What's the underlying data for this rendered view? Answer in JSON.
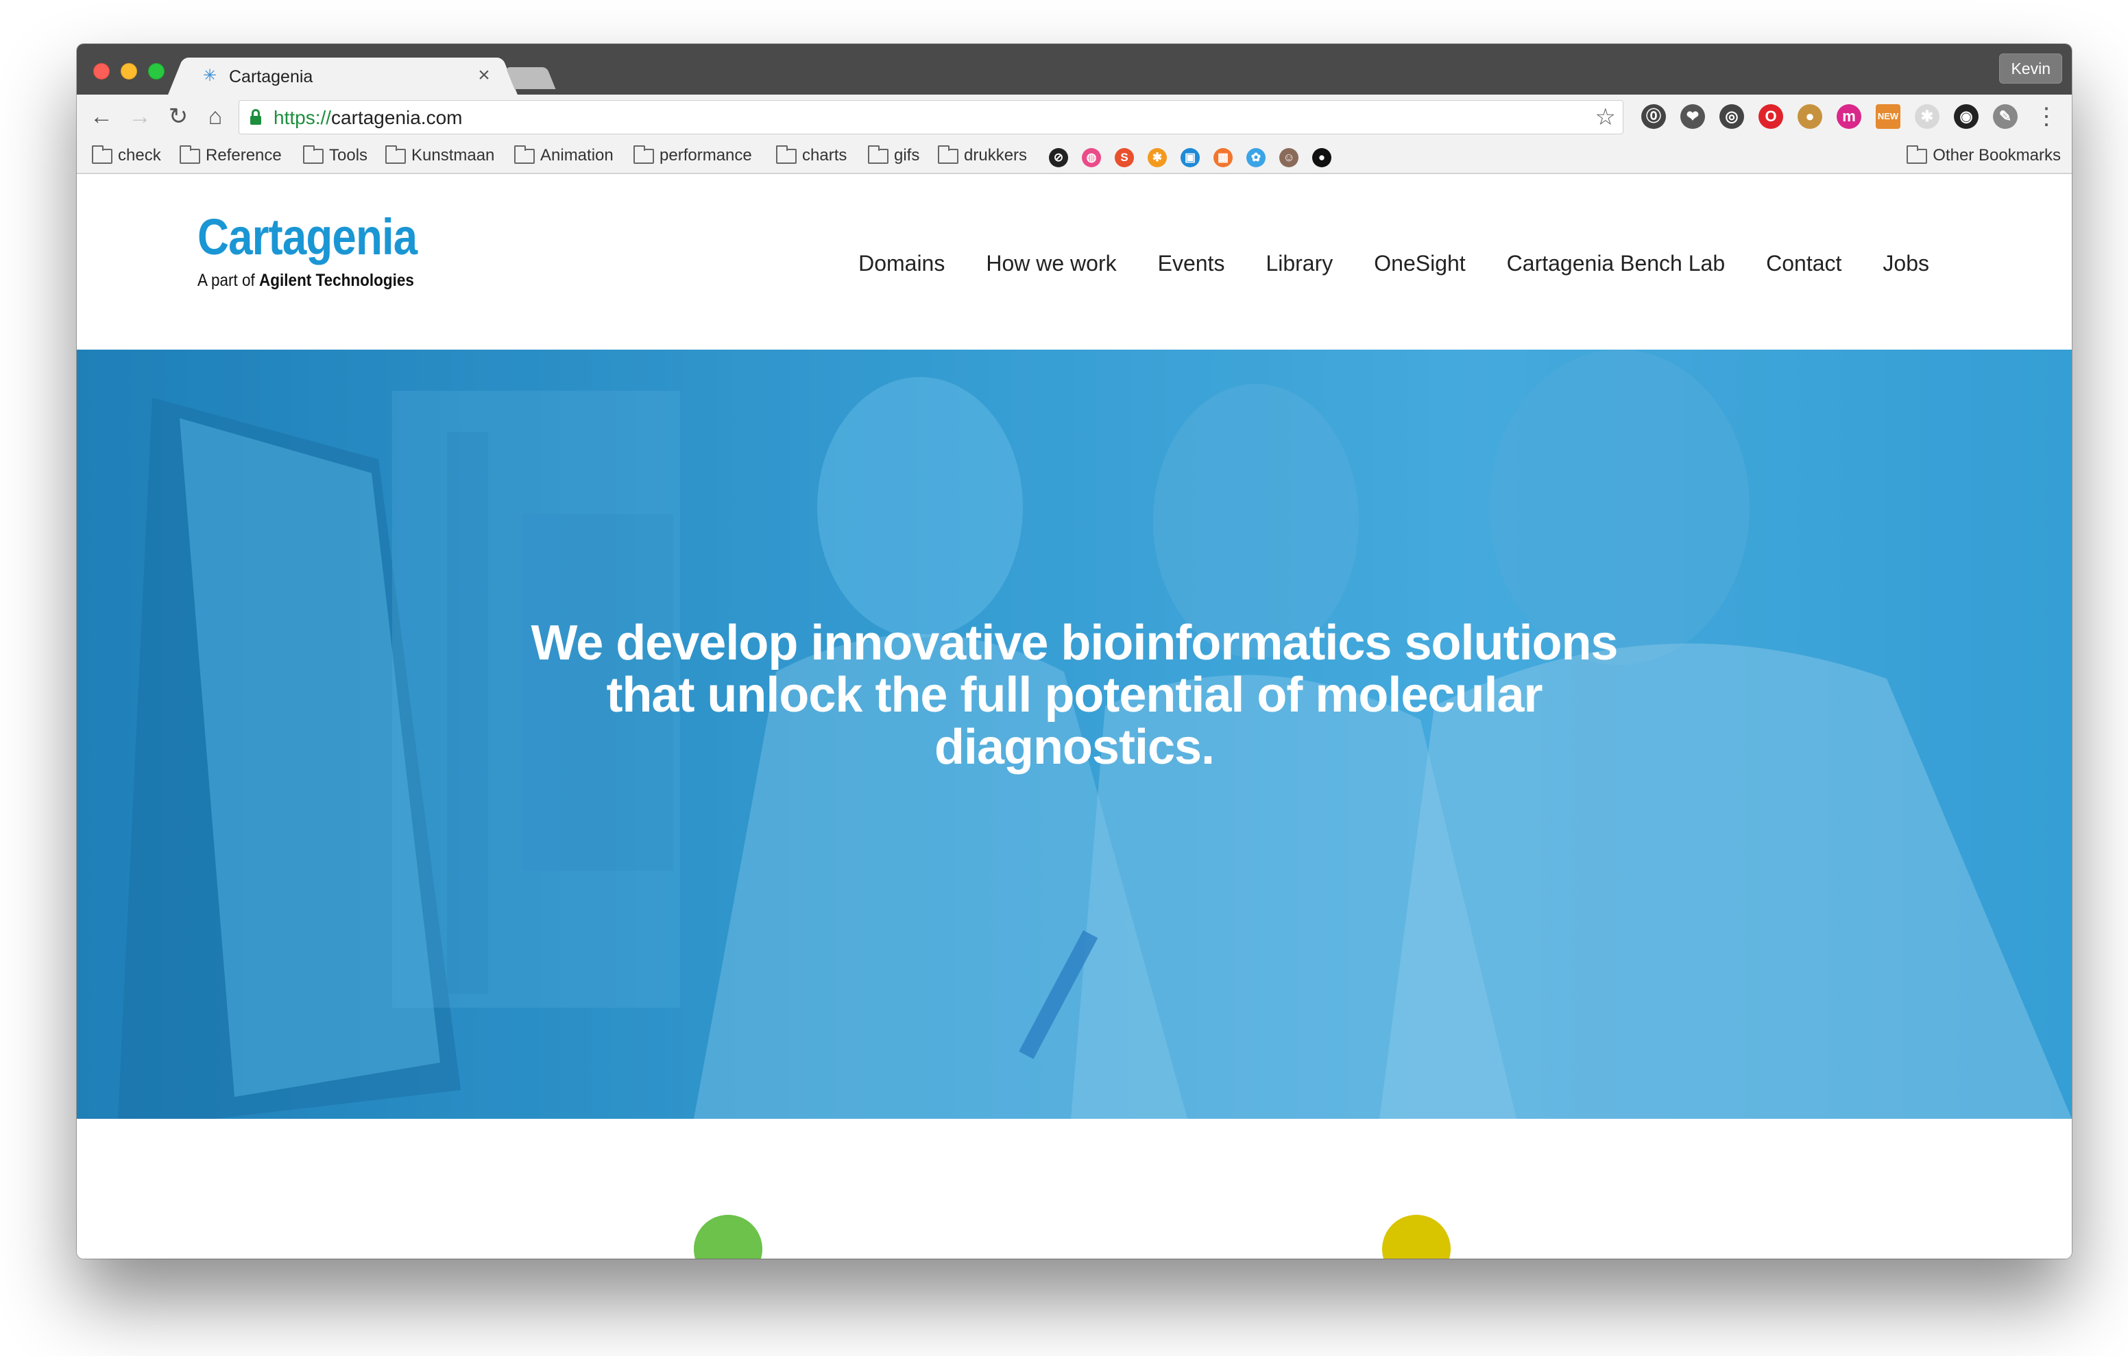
{
  "browser": {
    "tab_title": "Cartagenia",
    "url_scheme": "https://",
    "url_host": "cartagenia.com",
    "profile_name": "Kevin",
    "extensions": [
      {
        "name": "1password-icon",
        "color": "#444444",
        "glyph": "⓪"
      },
      {
        "name": "pocket-icon",
        "color": "#555555",
        "glyph": "❤"
      },
      {
        "name": "globe-icon",
        "color": "#444444",
        "glyph": "◎"
      },
      {
        "name": "opera-icon",
        "color": "#e0232a",
        "glyph": "O"
      },
      {
        "name": "cookie-icon",
        "color": "#c7923e",
        "glyph": "●"
      },
      {
        "name": "m-script-icon",
        "color": "#d9288a",
        "glyph": "m"
      },
      {
        "name": "new-badge-icon",
        "color": "#e58a2e",
        "glyph": "NEW"
      },
      {
        "name": "puzzle-icon",
        "color": "#d8d8d8",
        "glyph": "✱"
      },
      {
        "name": "colorpicker-icon",
        "color": "#222222",
        "glyph": "◉"
      },
      {
        "name": "eraser-icon",
        "color": "#888888",
        "glyph": "✎"
      }
    ]
  },
  "bookmarks": {
    "folders": [
      "check",
      "Reference",
      "Tools",
      "Kunstmaan",
      "Animation",
      "performance",
      "charts",
      "gifs",
      "drukkers"
    ],
    "icons": [
      {
        "name": "no-icon",
        "color": "#222222",
        "glyph": "⊘"
      },
      {
        "name": "dribbble-icon",
        "color": "#ea4c89",
        "glyph": "◍"
      },
      {
        "name": "s-icon",
        "color": "#e8502e",
        "glyph": "S"
      },
      {
        "name": "asterisk-icon",
        "color": "#f39a1e",
        "glyph": "✱"
      },
      {
        "name": "photo-icon",
        "color": "#1f8ad6",
        "glyph": "▣"
      },
      {
        "name": "orange-square-icon",
        "color": "#f2762e",
        "glyph": "▦"
      },
      {
        "name": "blue-circle-icon",
        "color": "#3ba4e6",
        "glyph": "✿"
      },
      {
        "name": "avatar-icon",
        "color": "#8a6b5a",
        "glyph": "☺"
      },
      {
        "name": "github-icon",
        "color": "#111111",
        "glyph": "●"
      }
    ],
    "other": "Other Bookmarks"
  },
  "site": {
    "logo_name": "Cartagenia",
    "logo_sub_prefix": "A part of ",
    "logo_sub_company": "Agilent Technologies",
    "nav": [
      "Domains",
      "How we work",
      "Events",
      "Library",
      "OneSight",
      "Cartagenia Bench Lab",
      "Contact",
      "Jobs"
    ],
    "hero_lines": [
      "We develop innovative bioinformatics solutions",
      "that unlock the full potential of molecular",
      "diagnostics."
    ],
    "feature_icons": [
      {
        "name": "clipboard-icon",
        "color": "#6cc24a"
      },
      {
        "name": "microscope-icon",
        "color": "#d9c400"
      }
    ]
  },
  "colors": {
    "brand_blue": "#1a96d4",
    "hero_overlay": "#3aa5da"
  }
}
